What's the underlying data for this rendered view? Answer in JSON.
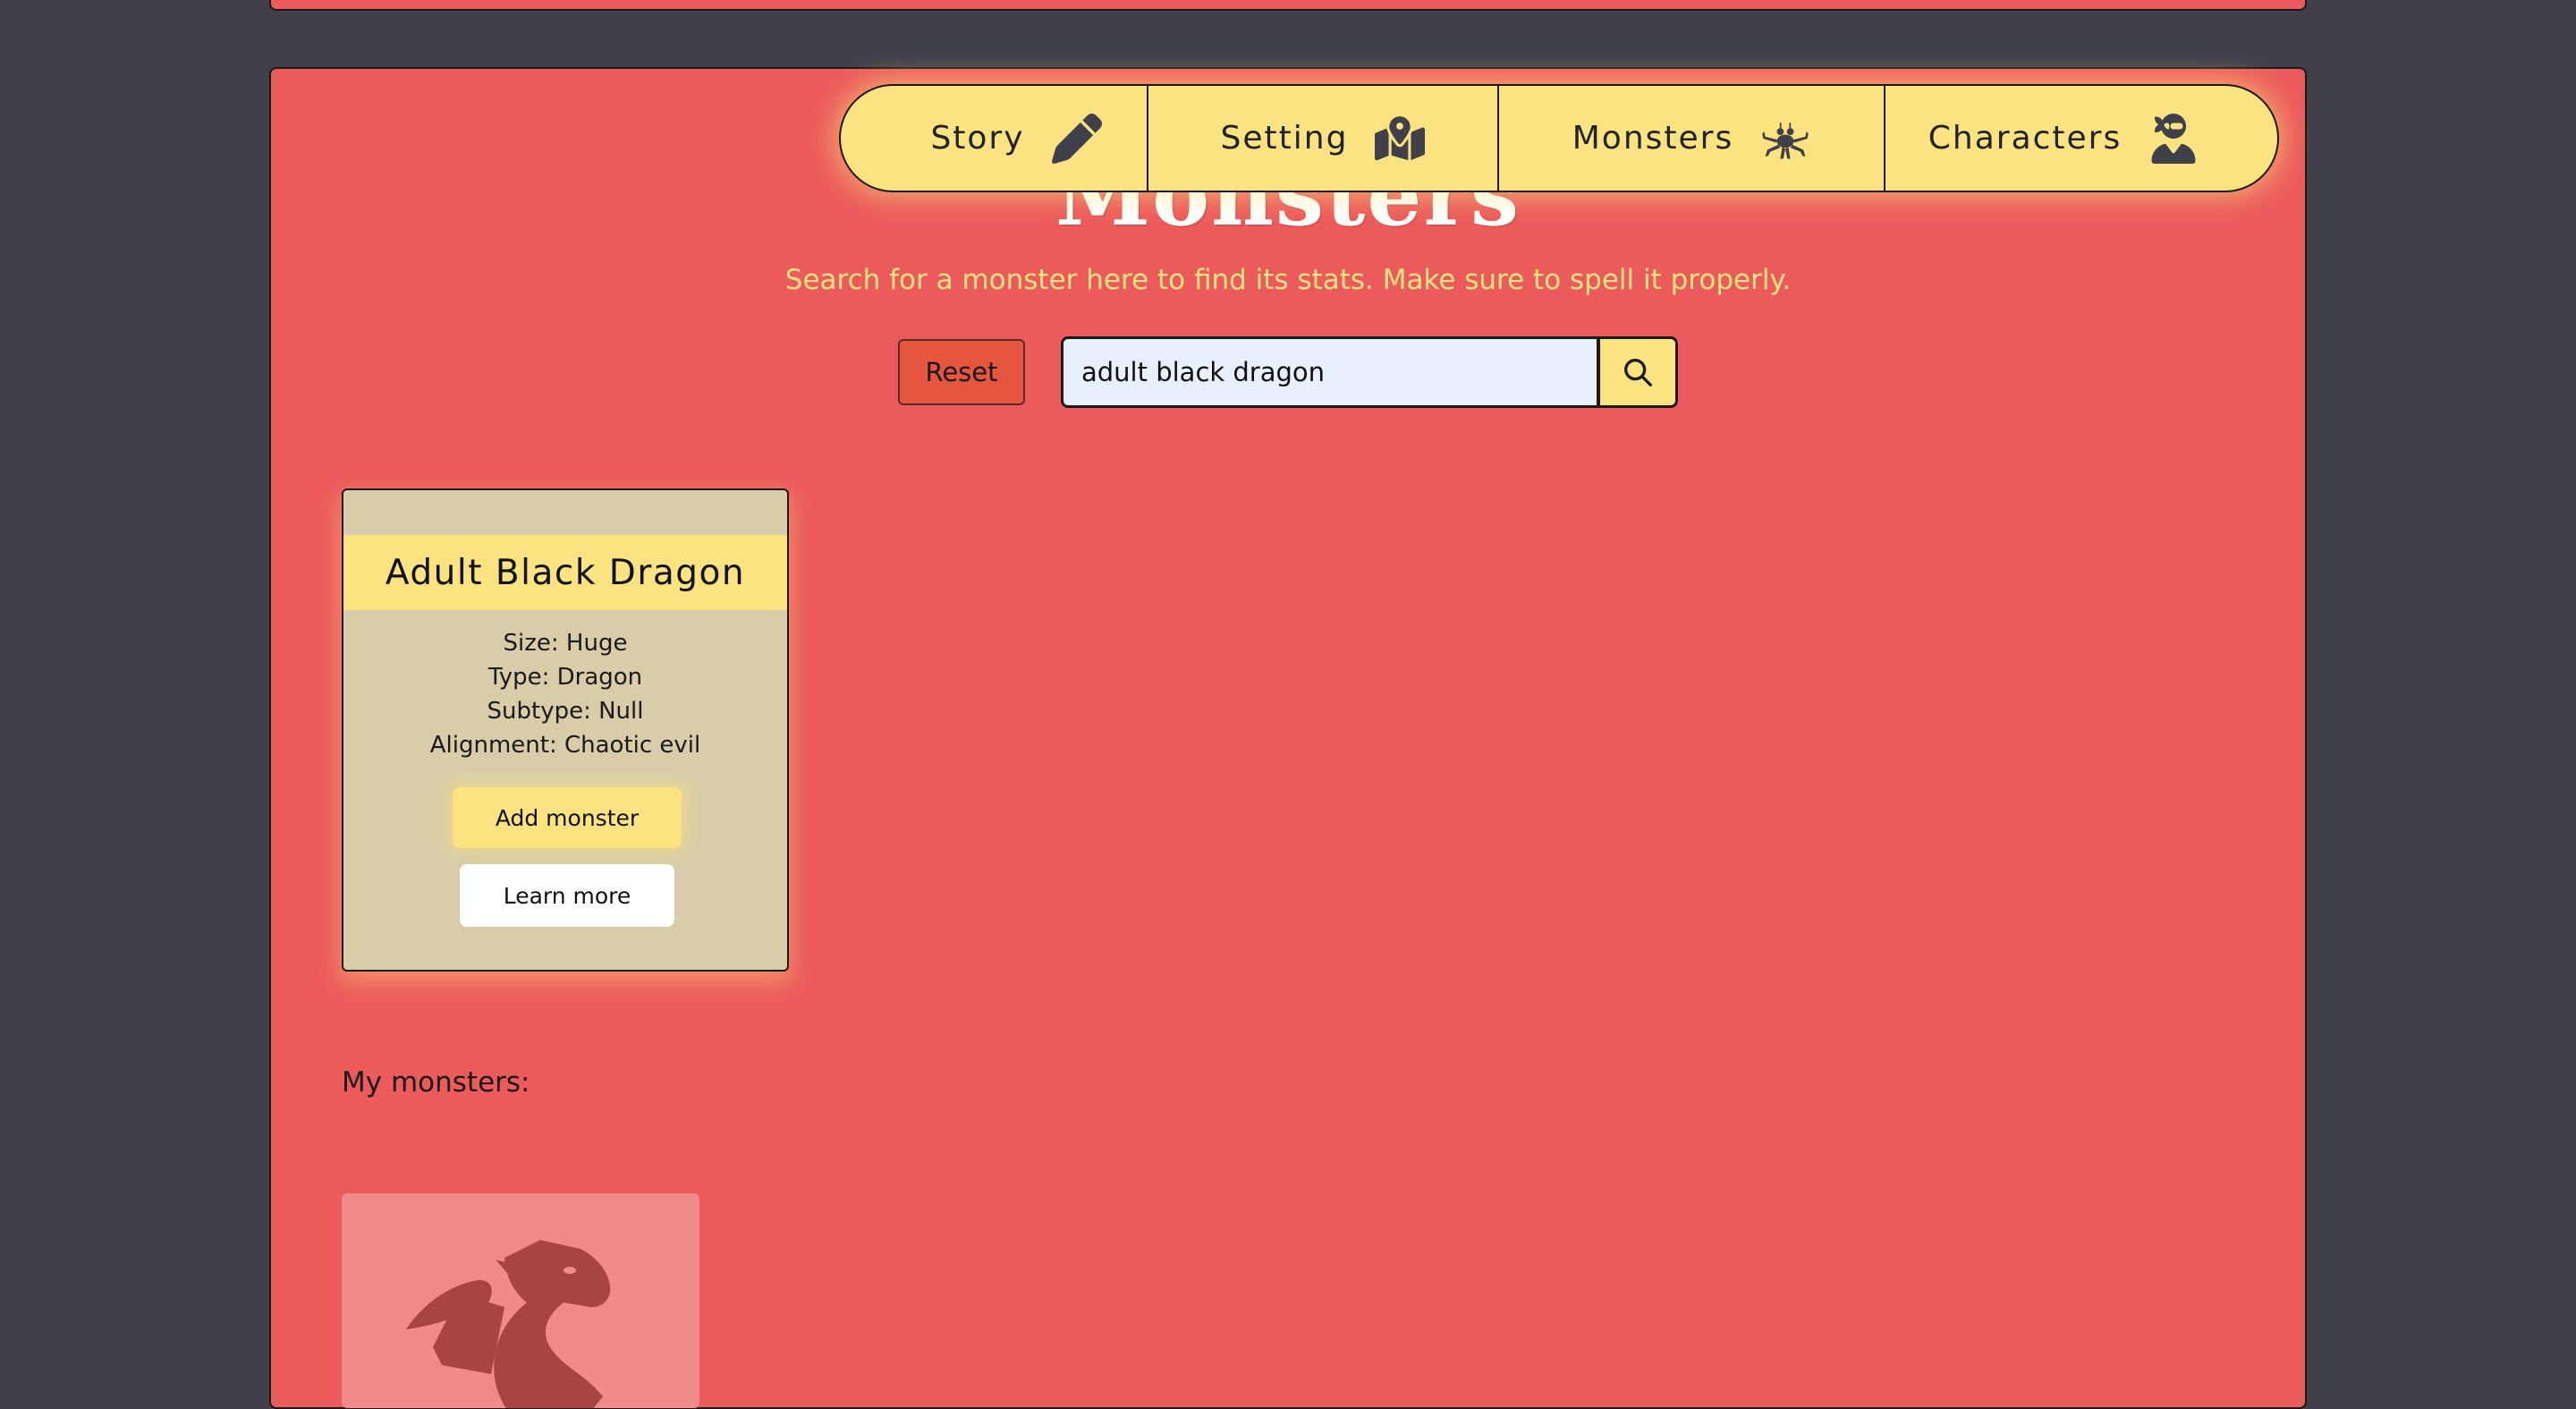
{
  "nav": {
    "items": [
      {
        "label": "Story",
        "icon": "pencil-icon"
      },
      {
        "label": "Setting",
        "icon": "map-icon"
      },
      {
        "label": "Monsters",
        "icon": "monster-icon"
      },
      {
        "label": "Characters",
        "icon": "user-ninja-icon"
      }
    ]
  },
  "header": {
    "title": "Monsters",
    "subtitle": "Search for a monster here to find its stats. Make sure to spell it properly."
  },
  "search": {
    "reset_label": "Reset",
    "value": "adult black dragon",
    "button_icon": "search-icon"
  },
  "result_card": {
    "name": "Adult Black Dragon",
    "size": "Size: Huge",
    "type": "Type: Dragon",
    "subtype": "Subtype: Null",
    "alignment": "Alignment: Chaotic evil",
    "add_label": "Add monster",
    "learn_label": "Learn more"
  },
  "my_monsters": {
    "label": "My monsters:",
    "items": [
      {
        "icon": "dragon-icon"
      }
    ]
  },
  "colors": {
    "background": "#40404b",
    "panel": "#ec5b5b",
    "accent_yellow": "#fbe382",
    "card": "#d8cda8",
    "reset": "#e5553f",
    "search_field": "#e8effd"
  }
}
